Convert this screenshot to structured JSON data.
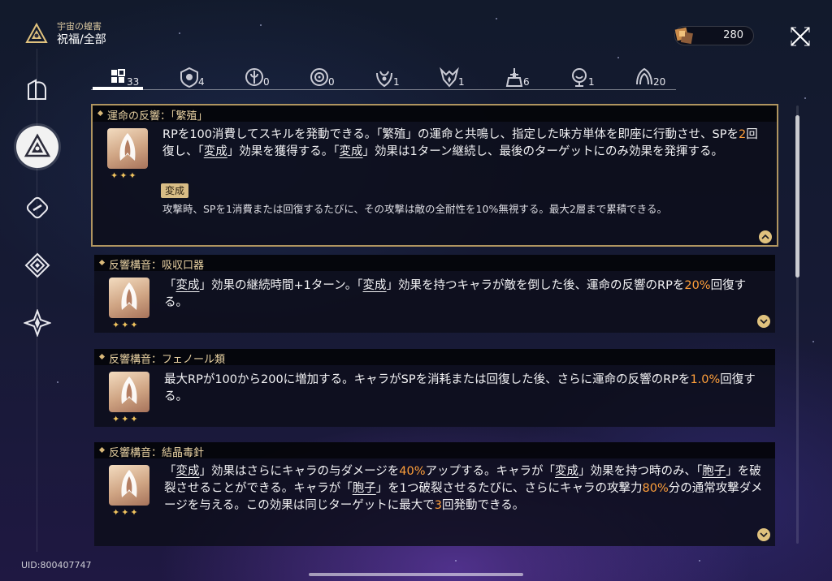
{
  "header": {
    "subtitle": "宇宙の蝗害",
    "title": "祝福/全部"
  },
  "currency": {
    "value": "280"
  },
  "uid": "UID:800407747",
  "tabs": [
    {
      "icon": "all-grid-icon",
      "count": "33",
      "active": true
    },
    {
      "icon": "preservation-icon",
      "count": "4"
    },
    {
      "icon": "remembrance-icon",
      "count": "0"
    },
    {
      "icon": "nihility-icon",
      "count": "0"
    },
    {
      "icon": "abundance-icon",
      "count": "1"
    },
    {
      "icon": "the-hunt-icon",
      "count": "1"
    },
    {
      "icon": "destruction-icon",
      "count": "6"
    },
    {
      "icon": "elation-icon",
      "count": "1"
    },
    {
      "icon": "propagation-icon",
      "count": "20"
    }
  ],
  "cards": [
    {
      "title": "運命の反響：「繁殖」",
      "stars": "✦✦✦",
      "desc_html": "RPを100消費してスキルを発動できる。「繁殖」の運命と共鳴し、指定した味方単体を即座に行動させ、SPを<span class=\"hl\">2</span>回復し、「<span class=\"ul\">変成</span>」効果を獲得する。「<span class=\"ul\">変成</span>」効果は1ターン継続し、最後のターゲットにのみ効果を発揮する。",
      "tag": "変成",
      "subdesc": "攻撃時、SPを1消費または回復するたびに、その攻撃は敵の全耐性を10%無視する。最大2層まで累積できる。",
      "expanded": true
    },
    {
      "title": "反響構音：吸収口器",
      "stars": "✦✦✦",
      "desc_html": "「<span class=\"ul\">変成</span>」効果の継続時間+1ターン。「<span class=\"ul\">変成</span>」効果を持つキャラが敵を倒した後、運命の反響のRPを<span class=\"hl\">20%</span>回復する。"
    },
    {
      "title": "反響構音：フェノール類",
      "stars": "✦✦✦",
      "desc_html": "最大RPが100から200に増加する。キャラがSPを消耗または回復した後、さらに運命の反響のRPを<span class=\"hl\">1.0%</span>回復する。"
    },
    {
      "title": "反響構音：結晶毒針",
      "stars": "✦✦✦",
      "desc_html": "「<span class=\"ul\">変成</span>」効果はさらにキャラの与ダメージを<span class=\"hl\">40%</span>アップする。キャラが「<span class=\"ul\">変成</span>」効果を持つ時のみ、「<span class=\"ul\">胞子</span>」を破裂させることができる。キャラが「<span class=\"ul\">胞子</span>」を1つ破裂させるたびに、さらにキャラの攻撃力<span class=\"hl\">80%</span>分の通常攻撃ダメージを与える。この効果は同じターゲットに最大で<span class=\"hl\">3</span>回発動できる。"
    }
  ]
}
